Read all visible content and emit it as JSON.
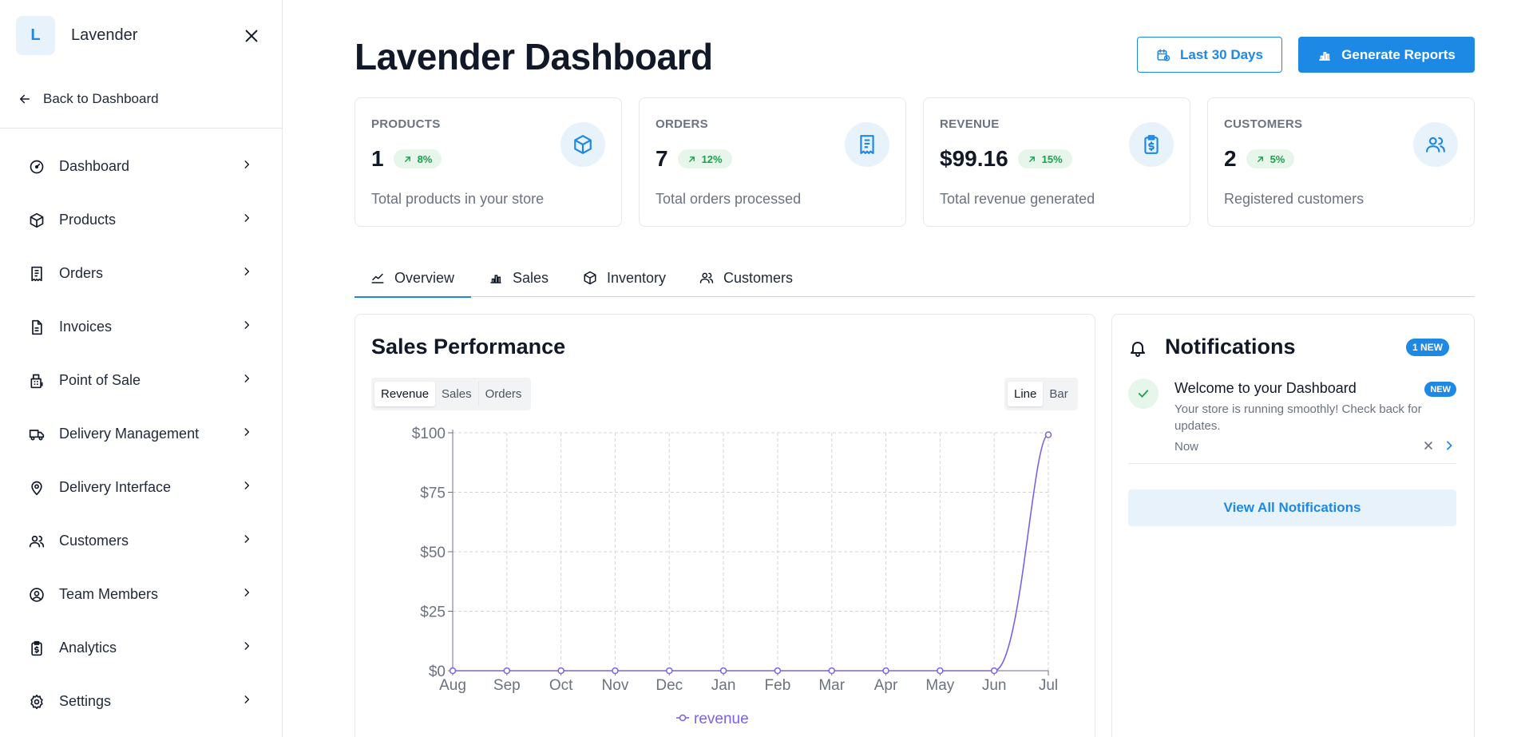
{
  "sidebar": {
    "brand_initial": "L",
    "brand_name": "Lavender",
    "back_label": "Back to Dashboard",
    "items": [
      {
        "label": "Dashboard",
        "icon": "gauge-icon"
      },
      {
        "label": "Products",
        "icon": "box-icon"
      },
      {
        "label": "Orders",
        "icon": "receipt-icon"
      },
      {
        "label": "Invoices",
        "icon": "file-icon"
      },
      {
        "label": "Point of Sale",
        "icon": "register-icon"
      },
      {
        "label": "Delivery Management",
        "icon": "truck-icon"
      },
      {
        "label": "Delivery Interface",
        "icon": "map-pin-icon"
      },
      {
        "label": "Customers",
        "icon": "users-icon"
      },
      {
        "label": "Team Members",
        "icon": "user-circle-icon"
      },
      {
        "label": "Analytics",
        "icon": "clipboard-dollar-icon"
      },
      {
        "label": "Settings",
        "icon": "gear-icon"
      }
    ]
  },
  "header": {
    "title": "Lavender Dashboard",
    "range_label": "Last 30 Days",
    "reports_label": "Generate Reports"
  },
  "stats": [
    {
      "label": "PRODUCTS",
      "value": "1",
      "change": "8%",
      "desc": "Total products in your store",
      "icon": "box-icon"
    },
    {
      "label": "ORDERS",
      "value": "7",
      "change": "12%",
      "desc": "Total orders processed",
      "icon": "receipt-icon"
    },
    {
      "label": "REVENUE",
      "value": "$99.16",
      "change": "15%",
      "desc": "Total revenue generated",
      "icon": "clipboard-dollar-icon"
    },
    {
      "label": "CUSTOMERS",
      "value": "2",
      "change": "5%",
      "desc": "Registered customers",
      "icon": "users-icon"
    }
  ],
  "tabs": [
    {
      "label": "Overview",
      "icon": "line-chart-icon",
      "active": true
    },
    {
      "label": "Sales",
      "icon": "bar-chart-icon",
      "active": false
    },
    {
      "label": "Inventory",
      "icon": "box-icon",
      "active": false
    },
    {
      "label": "Customers",
      "icon": "users-icon",
      "active": false
    }
  ],
  "sales_panel": {
    "title": "Sales Performance",
    "metric_options": [
      "Revenue",
      "Sales",
      "Orders"
    ],
    "metric_selected": "Revenue",
    "chart_type_options": [
      "Line",
      "Bar"
    ],
    "chart_type_selected": "Line"
  },
  "chart_data": {
    "type": "line",
    "categories": [
      "Aug",
      "Sep",
      "Oct",
      "Nov",
      "Dec",
      "Jan",
      "Feb",
      "Mar",
      "Apr",
      "May",
      "Jun",
      "Jul"
    ],
    "series": [
      {
        "name": "revenue",
        "values": [
          0,
          0,
          0,
          0,
          0,
          0,
          0,
          0,
          0,
          0,
          0,
          99.16
        ]
      }
    ],
    "yticks": [
      "$0",
      "$25",
      "$50",
      "$75",
      "$100"
    ],
    "ylim": [
      0,
      100
    ],
    "grid": true,
    "legend": "bottom",
    "color": "#7b61e8"
  },
  "notifications": {
    "title": "Notifications",
    "new_count_label": "1 NEW",
    "items": [
      {
        "title": "Welcome to your Dashboard",
        "badge": "NEW",
        "message": "Your store is running smoothly! Check back for updates.",
        "time": "Now"
      }
    ],
    "view_all_label": "View All Notifications"
  },
  "colors": {
    "accent": "#1e88e5",
    "success": "#16a34a",
    "series": "#7b61e8"
  }
}
